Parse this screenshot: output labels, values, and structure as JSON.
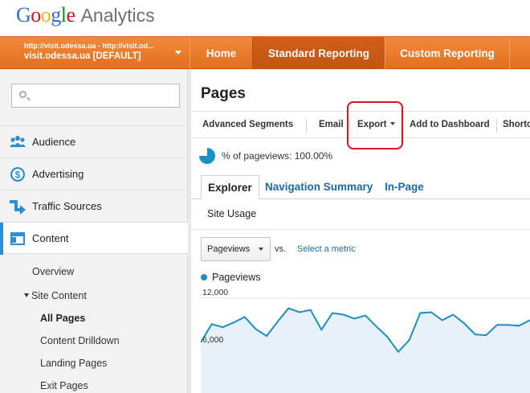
{
  "brand": {
    "google": "Google",
    "product": "Analytics"
  },
  "account": {
    "line1": "http://visit.odessa.ua - http://visit.od...",
    "line2": "visit.odessa.ua [DEFAULT]"
  },
  "nav": {
    "tabs": [
      {
        "label": "Home"
      },
      {
        "label": "Standard Reporting"
      },
      {
        "label": "Custom Reporting"
      }
    ],
    "active": "Standard Reporting"
  },
  "sidebar": {
    "search_placeholder": "",
    "sections": [
      {
        "label": "Audience",
        "icon": "people-icon"
      },
      {
        "label": "Advertising",
        "icon": "dollar-icon"
      },
      {
        "label": "Traffic Sources",
        "icon": "arrows-icon"
      },
      {
        "label": "Content",
        "icon": "content-icon"
      }
    ],
    "content_items": {
      "overview": "Overview",
      "site_content": "Site Content",
      "all_pages": "All Pages",
      "content_drilldown": "Content Drilldown",
      "landing_pages": "Landing Pages",
      "exit_pages": "Exit Pages"
    }
  },
  "main": {
    "title": "Pages",
    "toolbar": {
      "advanced_segments": "Advanced Segments",
      "email": "Email",
      "export": "Export",
      "add_to_dashboard": "Add to Dashboard",
      "shortcut": "Shortc"
    },
    "segment": "% of pageviews: 100.00%",
    "tabs": [
      "Explorer",
      "Navigation Summary",
      "In-Page"
    ],
    "subtab": "Site Usage",
    "metric_select": "Pageviews",
    "vs": "vs.",
    "select_metric": "Select a metric",
    "legend": "Pageviews"
  },
  "colors": {
    "accent_orange": "#e8761f",
    "link_blue": "#1a6aaa",
    "series_blue": "#1a8fc8",
    "highlight_red": "#d9141e"
  },
  "chart_data": {
    "type": "area",
    "ytick_labels": [
      "12,000",
      "6,000"
    ],
    "ylim": [
      0,
      13500
    ],
    "series": [
      {
        "name": "Pageviews",
        "values": [
          6400,
          8700,
          8300,
          8900,
          9600,
          8100,
          7200,
          9000,
          10700,
          10200,
          10500,
          8000,
          10100,
          9900,
          9400,
          9800,
          8400,
          7100,
          5200,
          6700,
          10100,
          10200,
          9200,
          9900,
          8800,
          7400,
          7300,
          8600,
          8600,
          8500,
          9200
        ]
      }
    ]
  }
}
